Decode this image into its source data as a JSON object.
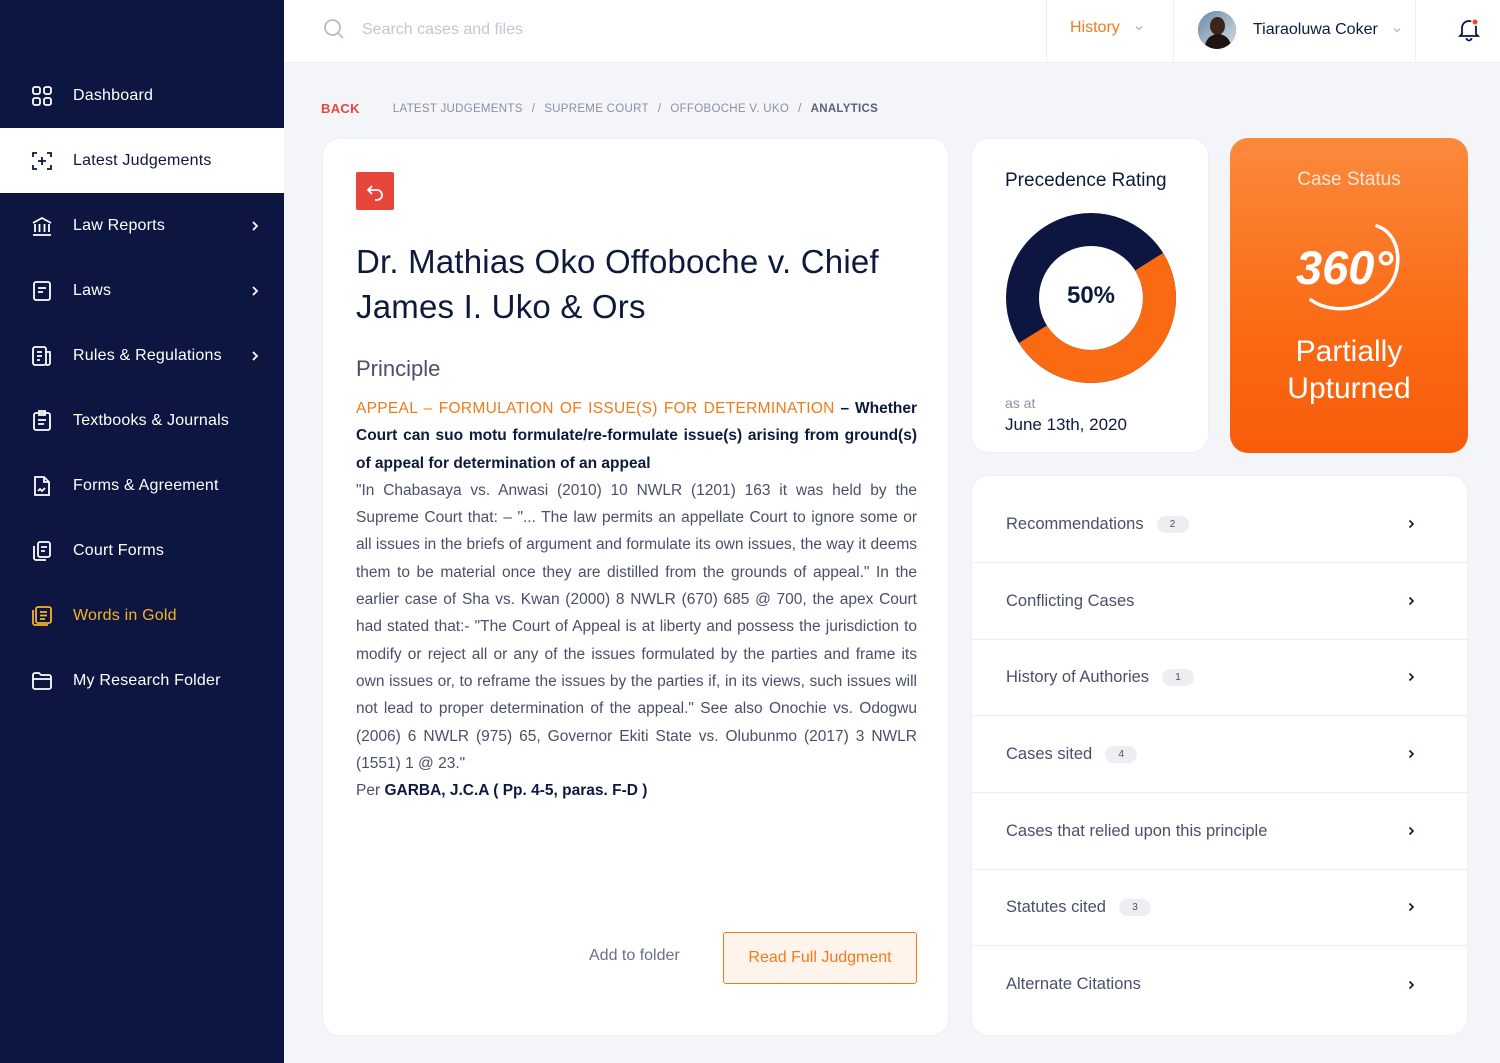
{
  "sidebar": {
    "items": [
      {
        "label": "Dashboard",
        "icon": "dashboard-icon"
      },
      {
        "label": "Latest Judgements",
        "icon": "latest-judgements-icon"
      },
      {
        "label": "Law Reports",
        "icon": "law-reports-icon"
      },
      {
        "label": "Laws",
        "icon": "laws-icon"
      },
      {
        "label": "Rules & Regulations",
        "icon": "rules-icon"
      },
      {
        "label": "Textbooks & Journals",
        "icon": "textbooks-icon"
      },
      {
        "label": "Forms & Agreement",
        "icon": "forms-icon"
      },
      {
        "label": "Court Forms",
        "icon": "court-forms-icon"
      },
      {
        "label": "Words in Gold",
        "icon": "words-in-gold-icon"
      },
      {
        "label": "My Research Folder",
        "icon": "folder-icon"
      }
    ]
  },
  "header": {
    "search_placeholder": "Search cases and files",
    "history_label": "History",
    "user_name": "Tiaraoluwa Coker"
  },
  "breadcrumb": {
    "back": "BACK",
    "items": [
      "LATEST JUDGEMENTS",
      "SUPREME COURT",
      "OFFOBOCHE V. UKO"
    ],
    "current": "ANALYTICS",
    "separator": "/"
  },
  "case": {
    "title": "Dr. Mathias Oko Offoboche v. Chief James I. Uko & Ors",
    "principle_heading": "Principle",
    "principle_tag": "APPEAL – FORMULATION OF ISSUE(S) FOR DETERMINATION",
    "principle_dash": " – ",
    "principle_question": "Whether Court can suo motu formulate/re-formulate issue(s) arising from ground(s) of appeal for determination of an appeal",
    "principle_body": "\"In Chabasaya vs. Anwasi (2010) 10 NWLR (1201) 163 it was held by the Supreme Court that: – \"... The law permits an appellate Court to ignore some or all issues in the briefs of argument and formulate its own issues, the way it deems them to be material once they are distilled from the grounds of appeal.\" In the earlier case of Sha vs. Kwan (2000) 8 NWLR (670) 685 @ 700, the apex Court had stated that:- \"The Court of Appeal is at liberty and possess the jurisdiction to modify or reject all or any of the issues formulated by the parties and frame its own issues or, to reframe the issues by the parties if, in its views, such issues will not lead to proper determination of the appeal.\" See also Onochie vs. Odogwu (2006) 6 NWLR (975) 65, Governor Ekiti State vs. Olubunmo (2017) 3 NWLR (1551) 1 @ 23.\"",
    "per_label": "Per ",
    "per_author": "GARBA, J.C.A ( Pp. 4-5, paras. F-D )",
    "add_to_folder": "Add to folder",
    "read_full": "Read Full Judgment"
  },
  "precedence": {
    "title": "Precedence Rating",
    "value_label": "50%",
    "value_fraction": 0.5,
    "as_at_label": "as at",
    "date": "June 13th, 2020",
    "colors": {
      "filled": "#f96a12",
      "remaining": "#0c1640"
    }
  },
  "status": {
    "title": "Case Status",
    "logo_text": "360°",
    "value": "Partially Upturned"
  },
  "links": [
    {
      "label": "Recommendations",
      "badge": "2"
    },
    {
      "label": "Conflicting Cases",
      "badge": null
    },
    {
      "label": "History of Authories",
      "badge": "1"
    },
    {
      "label": "Cases sited",
      "badge": "4"
    },
    {
      "label": "Cases that relied upon this principle",
      "badge": null
    },
    {
      "label": "Statutes cited",
      "badge": "3"
    },
    {
      "label": "Alternate Citations",
      "badge": null
    }
  ],
  "colors": {
    "sidebar_bg": "#0c1640",
    "accent_orange": "#f07b1a",
    "accent_red": "#e8453c",
    "gold": "#f5b424"
  }
}
